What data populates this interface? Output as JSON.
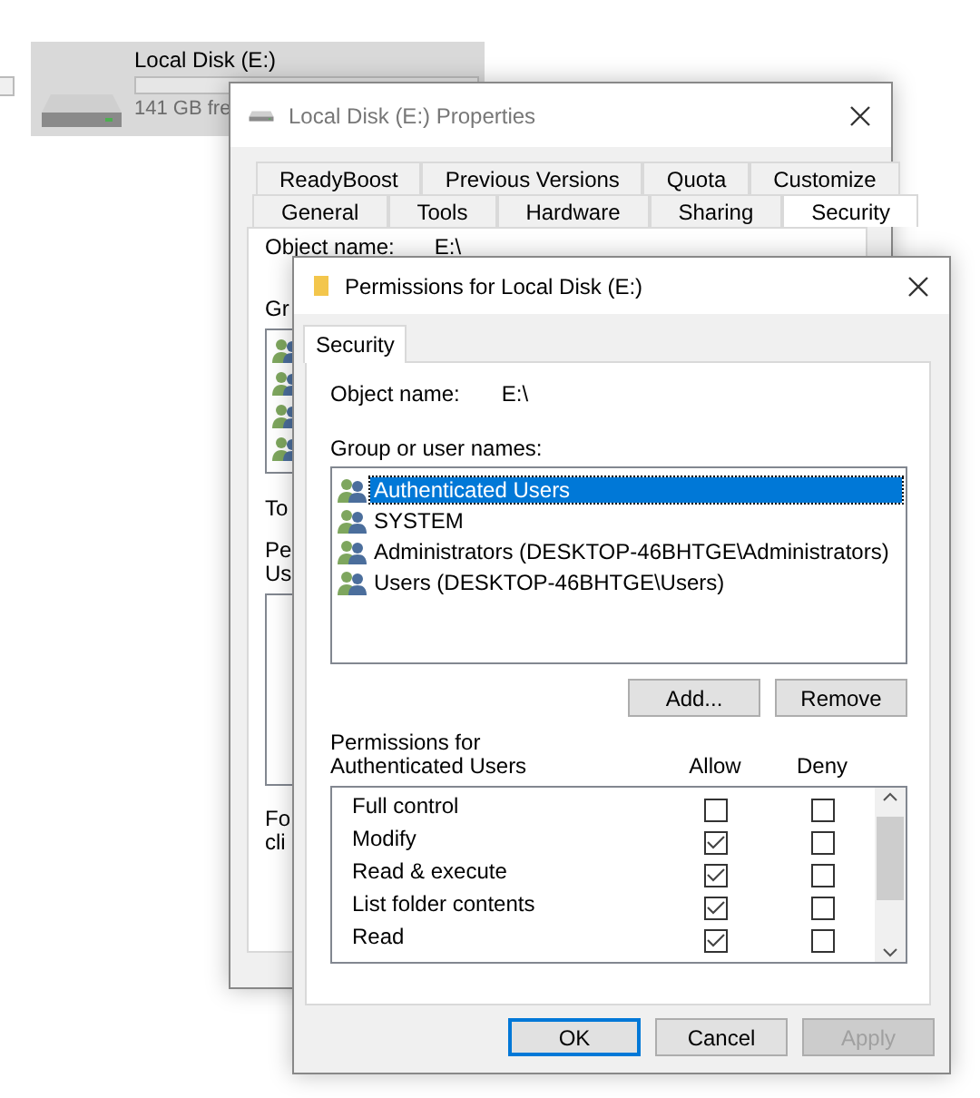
{
  "desktop_item": {
    "label": "Local Disk (E:)",
    "free_space": "141 GB fre",
    "selected": true
  },
  "properties_window": {
    "title": "Local Disk (E:) Properties",
    "tab_rows": [
      [
        {
          "label": "ReadyBoost",
          "selected": false
        },
        {
          "label": "Previous Versions",
          "selected": false
        },
        {
          "label": "Quota",
          "selected": false
        },
        {
          "label": "Customize",
          "selected": false
        }
      ],
      [
        {
          "label": "General",
          "selected": false
        },
        {
          "label": "Tools",
          "selected": false
        },
        {
          "label": "Hardware",
          "selected": false
        },
        {
          "label": "Sharing",
          "selected": false
        },
        {
          "label": "Security",
          "selected": true
        }
      ]
    ],
    "object_name_label": "Object name:",
    "object_name_value": "E:\\",
    "group_label": "Gr",
    "change_label": "To",
    "permissions_label": [
      "Pe",
      "Us"
    ],
    "footer_label": [
      "Fo",
      "cli"
    ]
  },
  "permissions_window": {
    "title": "Permissions for Local Disk (E:)",
    "tabs": [
      {
        "label": "Security",
        "selected": true
      }
    ],
    "object_name_label": "Object name:",
    "object_name_value": "E:\\",
    "group_label": "Group or user names:",
    "users": [
      {
        "name": "Authenticated Users",
        "selected": true
      },
      {
        "name": "SYSTEM",
        "selected": false
      },
      {
        "name": "Administrators (DESKTOP-46BHTGE\\Administrators)",
        "selected": false
      },
      {
        "name": "Users (DESKTOP-46BHTGE\\Users)",
        "selected": false
      }
    ],
    "user_buttons": [
      {
        "label": "Add...",
        "disabled": false
      },
      {
        "label": "Remove",
        "disabled": false
      }
    ],
    "permissions_label": "Permissions for Authenticated Users",
    "allow_header": "Allow",
    "deny_header": "Deny",
    "permissions": [
      {
        "name": "Full control",
        "allow": false,
        "deny": false
      },
      {
        "name": "Modify",
        "allow": true,
        "deny": false
      },
      {
        "name": "Read & execute",
        "allow": true,
        "deny": false
      },
      {
        "name": "List folder contents",
        "allow": true,
        "deny": false
      },
      {
        "name": "Read",
        "allow": true,
        "deny": false
      }
    ],
    "buttons": [
      {
        "label": "OK",
        "default": true,
        "disabled": false
      },
      {
        "label": "Cancel",
        "default": false,
        "disabled": false
      },
      {
        "label": "Apply",
        "default": false,
        "disabled": true
      }
    ]
  }
}
